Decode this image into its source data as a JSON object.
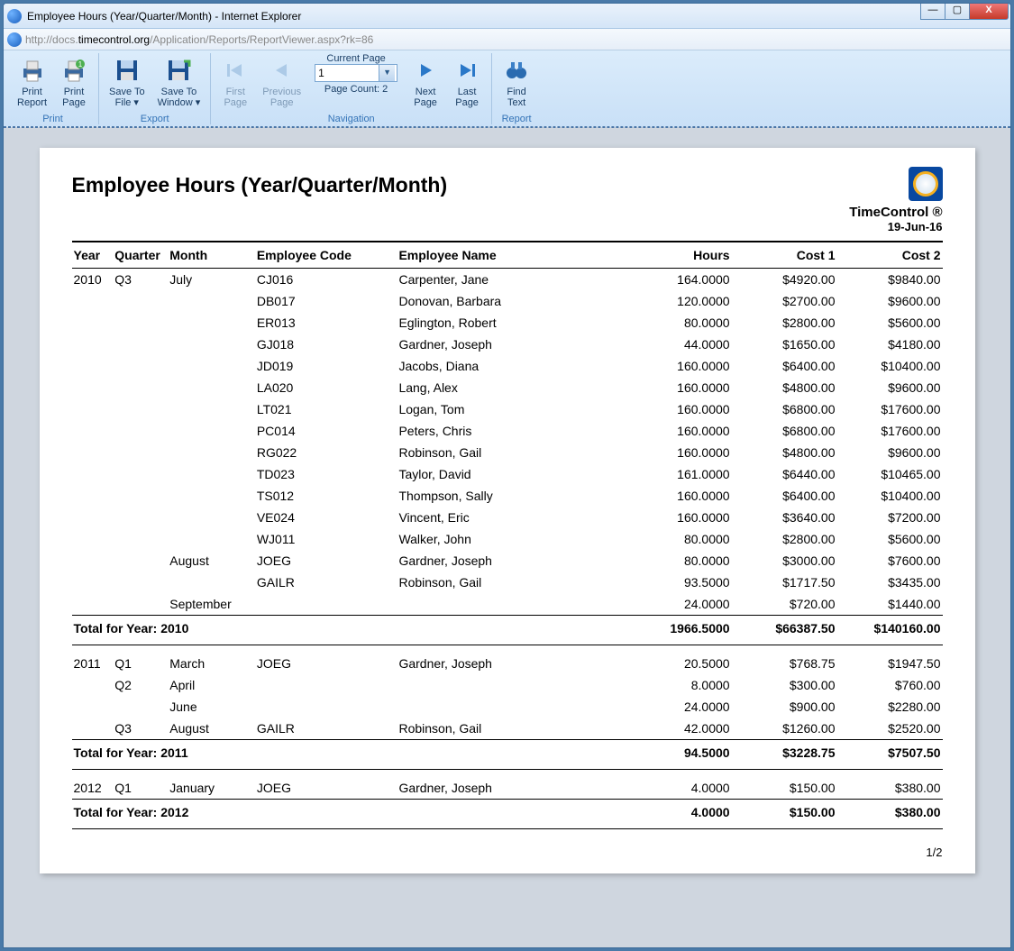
{
  "window": {
    "title": "Employee Hours (Year/Quarter/Month) - Internet Explorer",
    "url_prefix": "http://docs.",
    "url_domain": "timecontrol.org",
    "url_suffix": "/Application/Reports/ReportViewer.aspx?rk=86",
    "min": "—",
    "max": "▢",
    "close": "X"
  },
  "ribbon": {
    "print": {
      "label": "Print",
      "print_report": "Print\nReport",
      "print_page": "Print\nPage"
    },
    "export": {
      "label": "Export",
      "save_file": "Save To\nFile ▾",
      "save_window": "Save To\nWindow ▾"
    },
    "navigation": {
      "label": "Navigation",
      "first": "First\nPage",
      "previous": "Previous\nPage",
      "current_page_title": "Current Page",
      "current_page_value": "1",
      "page_count": "Page Count: 2",
      "next": "Next\nPage",
      "last": "Last\nPage"
    },
    "report": {
      "label": "Report",
      "find": "Find\nText"
    }
  },
  "report": {
    "title": "Employee Hours (Year/Quarter/Month)",
    "brand": "TimeControl ®",
    "date": "19-Jun-16",
    "page_number": "1/2",
    "columns": [
      "Year",
      "Quarter",
      "Month",
      "Employee Code",
      "Employee Name",
      "Hours",
      "Cost 1",
      "Cost 2"
    ],
    "sections": [
      {
        "year": "2010",
        "total_label": "Total for Year: 2010",
        "totals": {
          "hours": "1966.5000",
          "cost1": "$66387.50",
          "cost2": "$140160.00"
        },
        "rows": [
          {
            "quarter": "Q3",
            "month": "July",
            "code": "CJ016",
            "name": "Carpenter, Jane",
            "hours": "164.0000",
            "cost1": "$4920.00",
            "cost2": "$9840.00"
          },
          {
            "quarter": "",
            "month": "",
            "code": "DB017",
            "name": "Donovan, Barbara",
            "hours": "120.0000",
            "cost1": "$2700.00",
            "cost2": "$9600.00"
          },
          {
            "quarter": "",
            "month": "",
            "code": "ER013",
            "name": "Eglington, Robert",
            "hours": "80.0000",
            "cost1": "$2800.00",
            "cost2": "$5600.00"
          },
          {
            "quarter": "",
            "month": "",
            "code": "GJ018",
            "name": "Gardner, Joseph",
            "hours": "44.0000",
            "cost1": "$1650.00",
            "cost2": "$4180.00"
          },
          {
            "quarter": "",
            "month": "",
            "code": "JD019",
            "name": "Jacobs, Diana",
            "hours": "160.0000",
            "cost1": "$6400.00",
            "cost2": "$10400.00"
          },
          {
            "quarter": "",
            "month": "",
            "code": "LA020",
            "name": "Lang, Alex",
            "hours": "160.0000",
            "cost1": "$4800.00",
            "cost2": "$9600.00"
          },
          {
            "quarter": "",
            "month": "",
            "code": "LT021",
            "name": "Logan, Tom",
            "hours": "160.0000",
            "cost1": "$6800.00",
            "cost2": "$17600.00"
          },
          {
            "quarter": "",
            "month": "",
            "code": "PC014",
            "name": "Peters, Chris",
            "hours": "160.0000",
            "cost1": "$6800.00",
            "cost2": "$17600.00"
          },
          {
            "quarter": "",
            "month": "",
            "code": "RG022",
            "name": "Robinson, Gail",
            "hours": "160.0000",
            "cost1": "$4800.00",
            "cost2": "$9600.00"
          },
          {
            "quarter": "",
            "month": "",
            "code": "TD023",
            "name": "Taylor, David",
            "hours": "161.0000",
            "cost1": "$6440.00",
            "cost2": "$10465.00"
          },
          {
            "quarter": "",
            "month": "",
            "code": "TS012",
            "name": "Thompson, Sally",
            "hours": "160.0000",
            "cost1": "$6400.00",
            "cost2": "$10400.00"
          },
          {
            "quarter": "",
            "month": "",
            "code": "VE024",
            "name": "Vincent, Eric",
            "hours": "160.0000",
            "cost1": "$3640.00",
            "cost2": "$7200.00"
          },
          {
            "quarter": "",
            "month": "",
            "code": "WJ011",
            "name": "Walker, John",
            "hours": "80.0000",
            "cost1": "$2800.00",
            "cost2": "$5600.00"
          },
          {
            "quarter": "",
            "month": "August",
            "code": "JOEG",
            "name": "Gardner, Joseph",
            "hours": "80.0000",
            "cost1": "$3000.00",
            "cost2": "$7600.00"
          },
          {
            "quarter": "",
            "month": "",
            "code": "GAILR",
            "name": "Robinson, Gail",
            "hours": "93.5000",
            "cost1": "$1717.50",
            "cost2": "$3435.00"
          },
          {
            "quarter": "",
            "month": "September",
            "code": "",
            "name": "",
            "hours": "24.0000",
            "cost1": "$720.00",
            "cost2": "$1440.00"
          }
        ]
      },
      {
        "year": "2011",
        "total_label": "Total for Year: 2011",
        "totals": {
          "hours": "94.5000",
          "cost1": "$3228.75",
          "cost2": "$7507.50"
        },
        "rows": [
          {
            "quarter": "Q1",
            "month": "March",
            "code": "JOEG",
            "name": "Gardner, Joseph",
            "hours": "20.5000",
            "cost1": "$768.75",
            "cost2": "$1947.50"
          },
          {
            "quarter": "Q2",
            "month": "April",
            "code": "",
            "name": "",
            "hours": "8.0000",
            "cost1": "$300.00",
            "cost2": "$760.00"
          },
          {
            "quarter": "",
            "month": "June",
            "code": "",
            "name": "",
            "hours": "24.0000",
            "cost1": "$900.00",
            "cost2": "$2280.00"
          },
          {
            "quarter": "Q3",
            "month": "August",
            "code": "GAILR",
            "name": "Robinson, Gail",
            "hours": "42.0000",
            "cost1": "$1260.00",
            "cost2": "$2520.00"
          }
        ]
      },
      {
        "year": "2012",
        "total_label": "Total for Year: 2012",
        "totals": {
          "hours": "4.0000",
          "cost1": "$150.00",
          "cost2": "$380.00"
        },
        "rows": [
          {
            "quarter": "Q1",
            "month": "January",
            "code": "JOEG",
            "name": "Gardner, Joseph",
            "hours": "4.0000",
            "cost1": "$150.00",
            "cost2": "$380.00"
          }
        ]
      }
    ]
  }
}
